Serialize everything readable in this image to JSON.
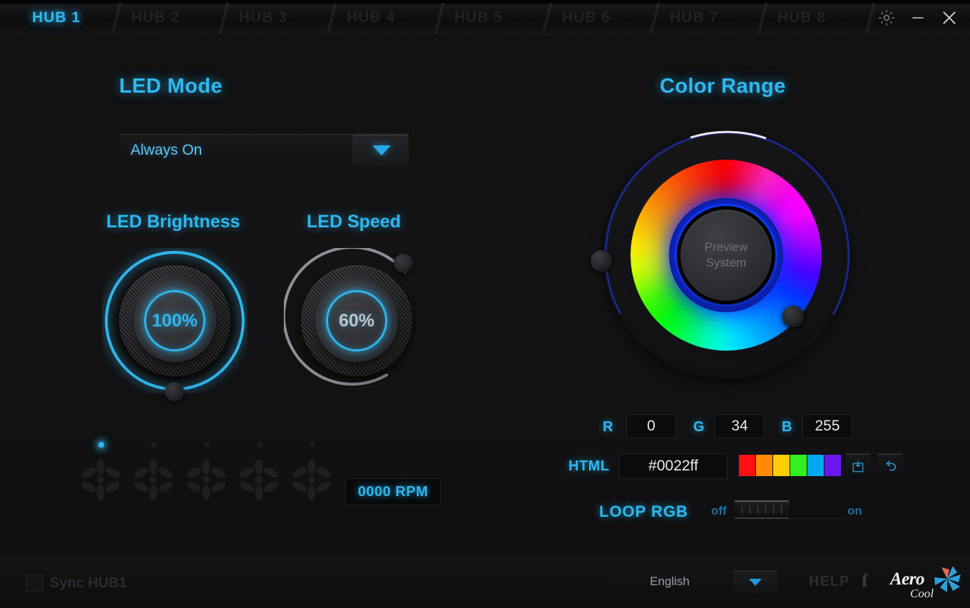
{
  "window": {
    "tabs": [
      {
        "label": "HUB 1",
        "active": true
      },
      {
        "label": "HUB 2",
        "active": false
      },
      {
        "label": "HUB 3",
        "active": false
      },
      {
        "label": "HUB 4",
        "active": false
      },
      {
        "label": "HUB 5",
        "active": false
      },
      {
        "label": "HUB 6",
        "active": false
      },
      {
        "label": "HUB 7",
        "active": false
      },
      {
        "label": "HUB 8",
        "active": false
      }
    ],
    "controls": {
      "settings": "gear-icon",
      "minimize": "minimize-icon",
      "close": "close-icon"
    },
    "accent_color": "#2eb8f0"
  },
  "led_mode": {
    "heading": "LED Mode",
    "selected": "Always On",
    "options": [
      "Always On"
    ]
  },
  "brightness": {
    "label": "LED Brightness",
    "value": "100%",
    "percent": 100,
    "ring_color": "#2fb4ea"
  },
  "speed": {
    "label": "LED Speed",
    "value": "60%",
    "percent": 60,
    "ring_color": "#8e9296"
  },
  "fans": {
    "count": 5,
    "active_index": 0,
    "rpm": "0000 RPM"
  },
  "color_range": {
    "heading": "Color Range",
    "preview_line1": "Preview",
    "preview_line2": "System",
    "r_label": "R",
    "r_value": "0",
    "g_label": "G",
    "g_value": "34",
    "b_label": "B",
    "b_value": "255",
    "html_label": "HTML",
    "html_value": "#0022ff",
    "swatches": [
      "#ff1010",
      "#ff8c00",
      "#ffcc00",
      "#33ee22",
      "#00a8f0",
      "#6a18f0"
    ],
    "save_icon": "save-icon",
    "reset_icon": "undo-icon",
    "loop_label": "LOOP RGB",
    "loop_off": "off",
    "loop_on": "on",
    "loop_state": "off"
  },
  "footer": {
    "sync_label": "Sync HUB1",
    "language": "English",
    "help": "HELP",
    "facebook": "f",
    "brand_top": "Aero",
    "brand_bottom": "Cool"
  }
}
